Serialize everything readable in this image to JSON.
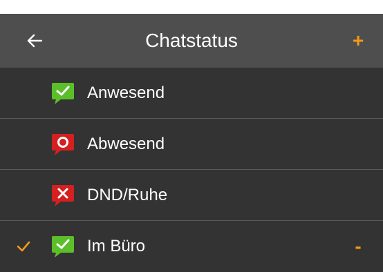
{
  "header": {
    "title": "Chatstatus",
    "back_icon": "arrow-left-icon",
    "add_label": "+"
  },
  "statuses": [
    {
      "label": "Anwesend",
      "icon": "chat-check-icon",
      "icon_color": "#5bbf2a",
      "selected": false
    },
    {
      "label": "Abwesend",
      "icon": "chat-circle-icon",
      "icon_color": "#d42020",
      "selected": false
    },
    {
      "label": "DND/Ruhe",
      "icon": "chat-x-icon",
      "icon_color": "#d42020",
      "selected": false
    },
    {
      "label": "Im Büro",
      "icon": "chat-check-icon",
      "icon_color": "#5bbf2a",
      "selected": true,
      "remove_label": "-"
    }
  ],
  "colors": {
    "accent": "#f29a1b",
    "header_bg": "#4e4e4e",
    "list_bg": "#333333",
    "divider": "#5b5b5b"
  }
}
